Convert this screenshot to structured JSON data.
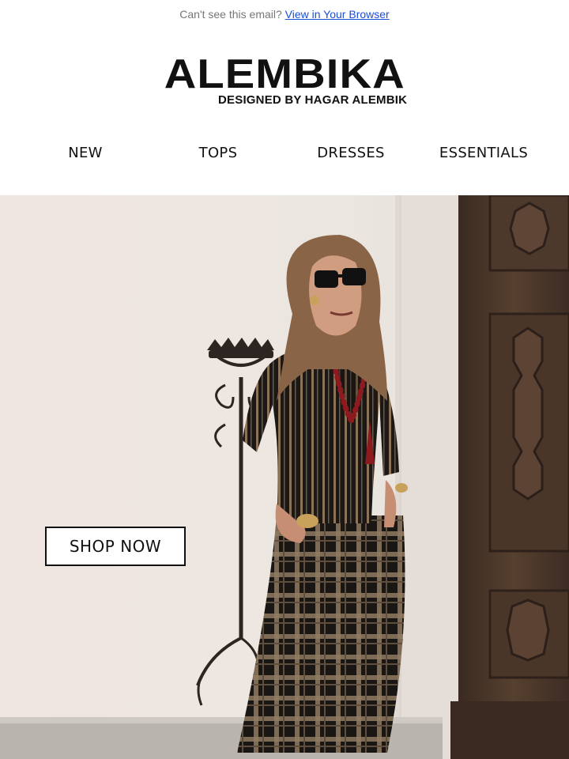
{
  "preheader": {
    "text": "Can't see this email?",
    "link": "View in Your Browser"
  },
  "brand": {
    "name": "ALEMBIKA",
    "tagline": "DESIGNED BY HAGAR ALEMBIK"
  },
  "nav": {
    "items": [
      "NEW",
      "TOPS",
      "DRESSES",
      "ESSENTIALS"
    ]
  },
  "hero": {
    "cta_label": "SHOP NOW"
  },
  "colors": {
    "link": "#1a4fd6",
    "text": "#111111",
    "wall": "#ede6e2",
    "door": "#4a342a"
  }
}
